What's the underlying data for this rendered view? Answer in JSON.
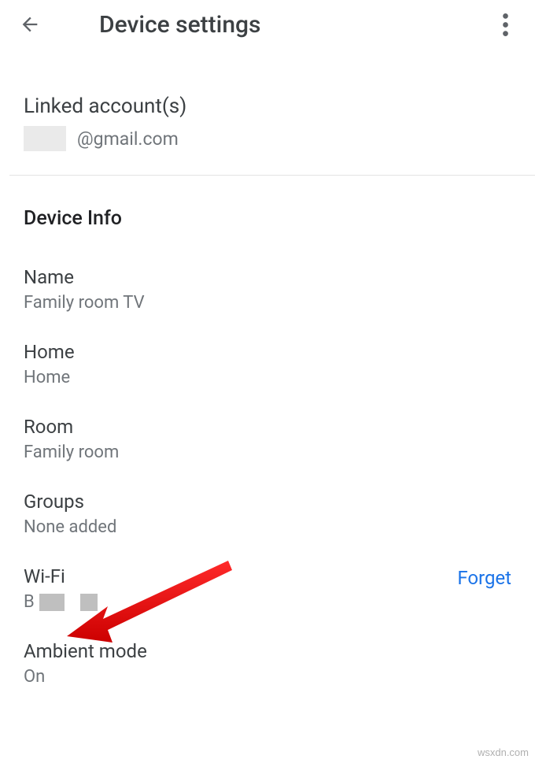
{
  "header": {
    "title": "Device settings"
  },
  "linked": {
    "heading": "Linked account(s)",
    "email_domain": "@gmail.com"
  },
  "device_info": {
    "heading": "Device Info",
    "name": {
      "label": "Name",
      "value": "Family room TV"
    },
    "home": {
      "label": "Home",
      "value": "Home"
    },
    "room": {
      "label": "Room",
      "value": "Family room"
    },
    "groups": {
      "label": "Groups",
      "value": "None added"
    },
    "wifi": {
      "label": "Wi-Fi",
      "prefix": "B",
      "forget": "Forget"
    },
    "ambient": {
      "label": "Ambient mode",
      "value": "On"
    }
  },
  "watermark": "wsxdn.com"
}
